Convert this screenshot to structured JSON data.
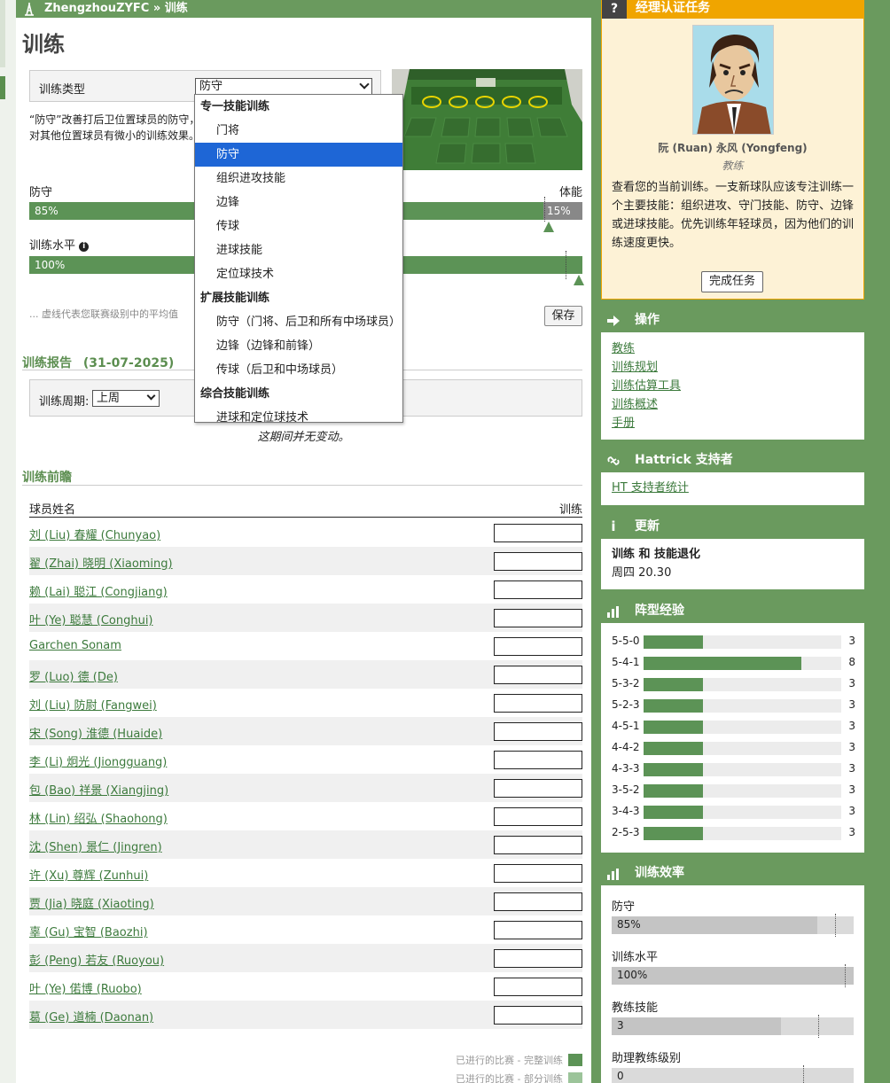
{
  "breadcrumb": "ZhengzhouZYFC » 训练",
  "page_title": "训练",
  "training_type": {
    "label": "训练类型",
    "selected": "防守",
    "description": "“防守”改善打后卫位置球员的防守，对其他位置球员有微小的训练效果。"
  },
  "dropdown": {
    "groups": [
      {
        "label": "专一技能训练",
        "items": [
          "门将",
          "防守",
          "组织进攻技能",
          "边锋",
          "传球",
          "进球技能",
          "定位球技术"
        ]
      },
      {
        "label": "扩展技能训练",
        "items": [
          "防守（门将、后卫和所有中场球员）",
          "边锋（边锋和前锋）",
          "传球（后卫和中场球员）"
        ]
      },
      {
        "label": "综合技能训练",
        "items": [
          "进球和定位球技术"
        ]
      }
    ]
  },
  "bars": {
    "defense_label": "防守",
    "defense_value": "85%",
    "defense_fraction": 0.85,
    "stamina_label": "体能",
    "stamina_value": "15%",
    "stamina_fraction": 0.15,
    "level_label": "训练水平",
    "level_value": "100%",
    "level_fraction": 1.0
  },
  "note": "... 虚线代表您联赛级别中的平均值",
  "save_label": "保存",
  "report": {
    "title": "训练报告",
    "date": "(31-07-2025)",
    "period_label": "训练周期:",
    "period_selected": "上周",
    "no_change": "这期间并无变动。"
  },
  "outlook": {
    "title": "训练前瞻",
    "col_name": "球员姓名",
    "col_training": "训练",
    "players": [
      "刘 (Liu) 春耀 (Chunyao)",
      "翟 (Zhai) 晓明 (Xiaoming)",
      "赖 (Lai) 聪江 (Congjiang)",
      "叶 (Ye) 聪慧 (Conghui)",
      "Garchen Sonam",
      "罗 (Luo) 德 (De)",
      "刘 (Liu) 防尉 (Fangwei)",
      "宋 (Song) 淮德 (Huaide)",
      "李 (Li) 炯光 (Jiongguang)",
      "包 (Bao) 祥景 (Xiangjing)",
      "林 (Lin) 绍弘 (Shaohong)",
      "沈 (Shen) 景仁 (Jingren)",
      "许 (Xu) 尊辉 (Zunhui)",
      "贾 (Jia) 晓庭 (Xiaoting)",
      "辜 (Gu) 宝智 (Baozhi)",
      "彭 (Peng) 若友 (Ruoyou)",
      "叶 (Ye) 偌博 (Ruobo)",
      "葛 (Ge) 道楠 (Daonan)"
    ],
    "legend_full": "已进行的比赛 - 完整训练",
    "legend_partial": "已进行的比赛 - 部分训练"
  },
  "sidebar": {
    "task": {
      "title": "经理认证任务",
      "coach_name": "阮 (Ruan) 永风 (Yongfeng)",
      "coach_role": "教练",
      "text": "查看您的当前训练。一支新球队应该专注训练一个主要技能：组织进攻、守门技能、防守、边锋或进球技能。优先训练年轻球员，因为他们的训练速度更快。",
      "button": "完成任务"
    },
    "actions": {
      "title": "操作",
      "links": [
        "教练",
        "训练规划",
        "训练估算工具",
        "训练概述",
        "手册"
      ]
    },
    "supporter": {
      "title": "Hattrick 支持者",
      "link": "HT 支持者统计"
    },
    "update": {
      "title": "更新",
      "headline": "训练 和 技能退化",
      "time": "周四 20.30"
    },
    "formation": {
      "title": "阵型经验",
      "rows": [
        {
          "name": "5-5-0",
          "value": "3"
        },
        {
          "name": "5-4-1",
          "value": "8"
        },
        {
          "name": "5-3-2",
          "value": "3"
        },
        {
          "name": "5-2-3",
          "value": "3"
        },
        {
          "name": "4-5-1",
          "value": "3"
        },
        {
          "name": "4-4-2",
          "value": "3"
        },
        {
          "name": "4-3-3",
          "value": "3"
        },
        {
          "name": "3-5-2",
          "value": "3"
        },
        {
          "name": "3-4-3",
          "value": "3"
        },
        {
          "name": "2-5-3",
          "value": "3"
        }
      ]
    },
    "efficiency": {
      "title": "训练效率",
      "rows": [
        {
          "label": "防守",
          "value": "85%",
          "fraction": 0.85
        },
        {
          "label": "训练水平",
          "value": "100%",
          "fraction": 1.0
        },
        {
          "label": "教练技能",
          "value": "3",
          "fraction": 0.7
        },
        {
          "label": "助理教练级别",
          "value": "0",
          "fraction": 0.0
        }
      ]
    }
  },
  "colors": {
    "green": "#6a9a5e",
    "bar_green": "#5c9356",
    "task_orange": "#f0a500",
    "select_blue": "#1e66d6"
  }
}
